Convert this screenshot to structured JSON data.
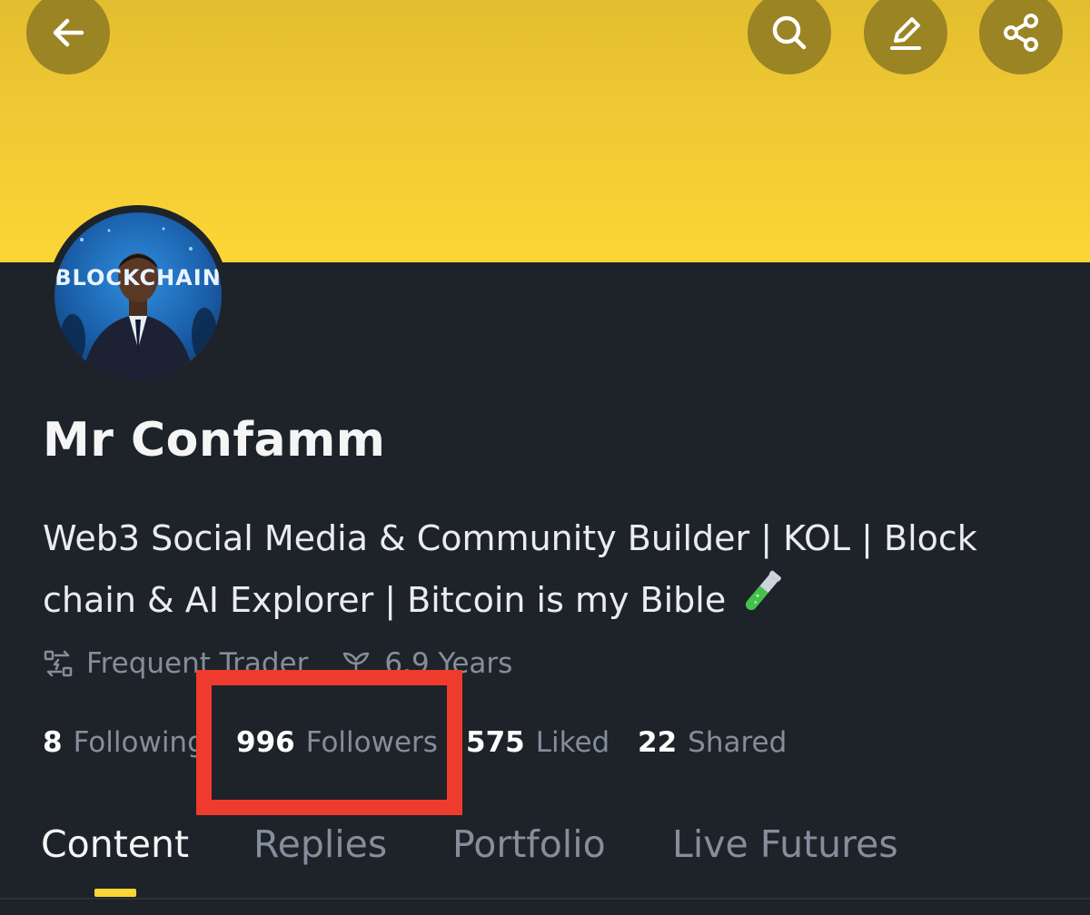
{
  "header": {
    "back_icon": "arrow-left-icon",
    "actions": [
      {
        "name": "search",
        "icon": "search-icon"
      },
      {
        "name": "edit",
        "icon": "pencil-icon"
      },
      {
        "name": "share",
        "icon": "share-icon"
      }
    ],
    "banner_color": "#fcd535"
  },
  "profile": {
    "avatar_text": "BLOCKCHAIN",
    "name": "Mr Confamm",
    "bio": "Web3 Social Media & Community Builder | KOL | Block chain & AI Explorer | Bitcoin is my Bible",
    "bio_emoji": "test-tube-icon",
    "badges": [
      {
        "icon": "trade-icon",
        "label": "Frequent Trader"
      },
      {
        "icon": "sprout-icon",
        "label": "6.9 Years"
      }
    ]
  },
  "stats": {
    "following": {
      "value": "8",
      "label": "Following"
    },
    "followers": {
      "value": "996",
      "label": "Followers"
    },
    "liked": {
      "value": "575",
      "label": "Liked"
    },
    "shared": {
      "value": "22",
      "label": "Shared"
    }
  },
  "annotation": {
    "color": "#ef3b2d"
  },
  "tabs": [
    {
      "label": "Content",
      "active": true
    },
    {
      "label": "Replies",
      "active": false
    },
    {
      "label": "Portfolio",
      "active": false
    },
    {
      "label": "Live Futures",
      "active": false
    }
  ],
  "colors": {
    "background": "#1e2329",
    "accent": "#fcd535",
    "muted_text": "#848e9c",
    "button_bg": "#9b8424"
  }
}
